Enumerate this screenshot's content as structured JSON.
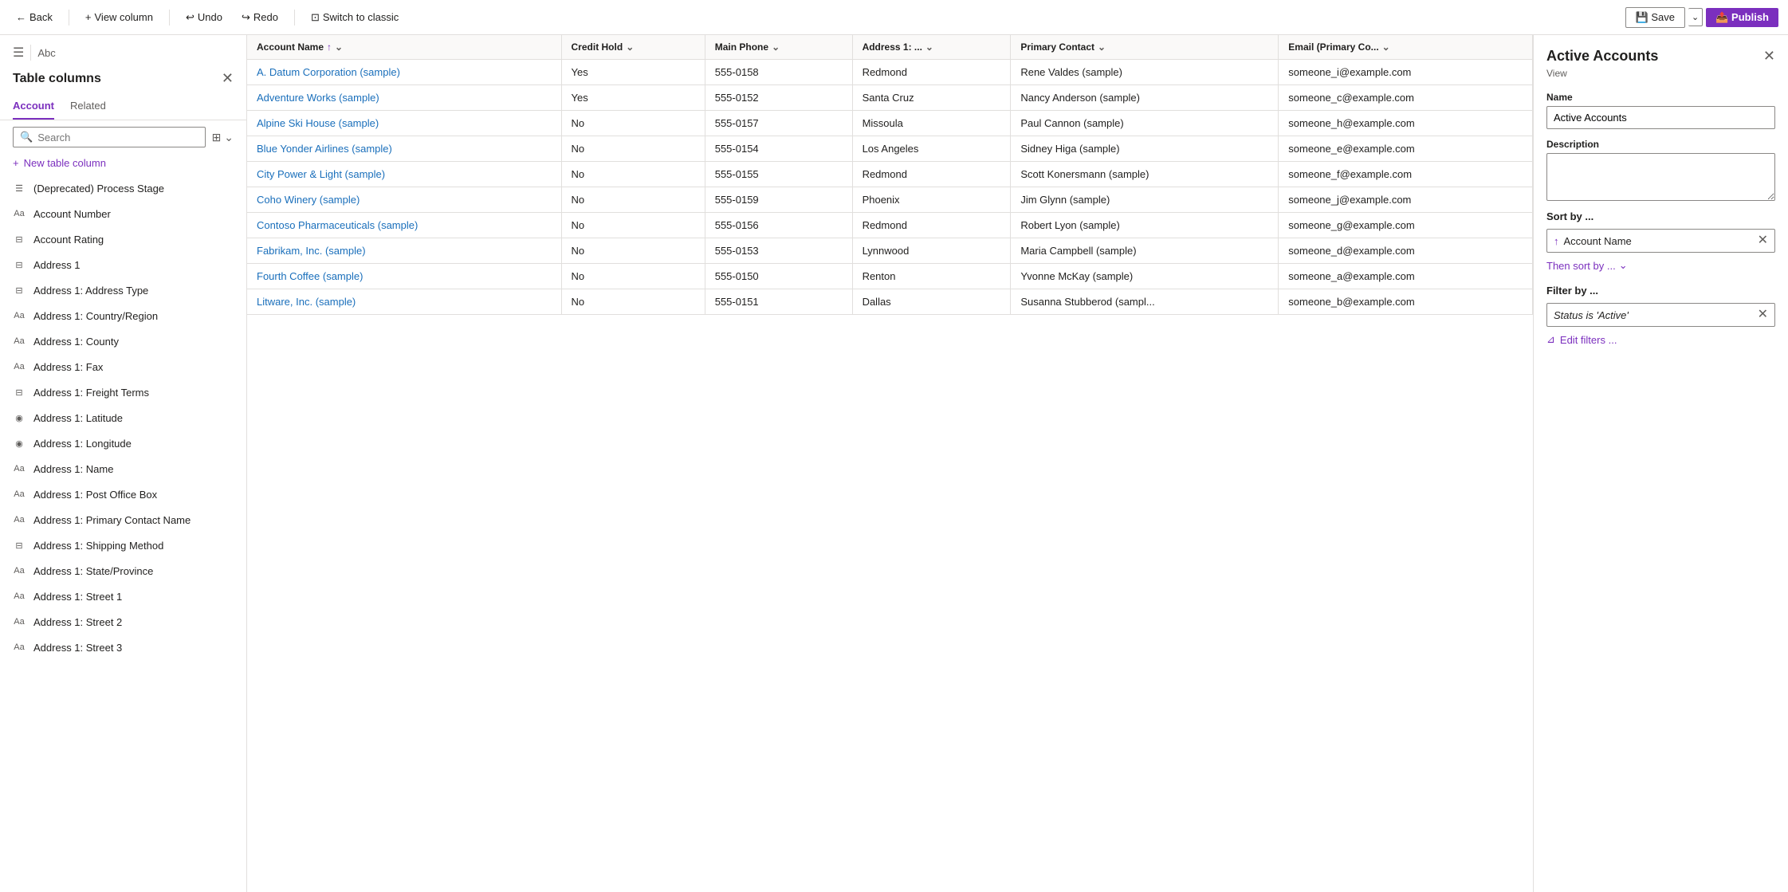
{
  "topbar": {
    "back_label": "Back",
    "view_column_label": "View column",
    "undo_label": "Undo",
    "redo_label": "Redo",
    "switch_label": "Switch to classic",
    "save_label": "Save",
    "publish_label": "Publish"
  },
  "sidebar": {
    "title": "Table columns",
    "close_icon": "✕",
    "tabs": [
      {
        "label": "Account",
        "active": true
      },
      {
        "label": "Related",
        "active": false
      }
    ],
    "search_placeholder": "Search",
    "new_column_label": "New table column",
    "columns": [
      {
        "label": "(Deprecated) Process Stage",
        "icon_type": "list"
      },
      {
        "label": "Account Number",
        "icon_type": "text"
      },
      {
        "label": "Account Rating",
        "icon_type": "select"
      },
      {
        "label": "Address 1",
        "icon_type": "select"
      },
      {
        "label": "Address 1: Address Type",
        "icon_type": "select"
      },
      {
        "label": "Address 1: Country/Region",
        "icon_type": "text"
      },
      {
        "label": "Address 1: County",
        "icon_type": "text"
      },
      {
        "label": "Address 1: Fax",
        "icon_type": "text"
      },
      {
        "label": "Address 1: Freight Terms",
        "icon_type": "select"
      },
      {
        "label": "Address 1: Latitude",
        "icon_type": "globe"
      },
      {
        "label": "Address 1: Longitude",
        "icon_type": "globe"
      },
      {
        "label": "Address 1: Name",
        "icon_type": "text"
      },
      {
        "label": "Address 1: Post Office Box",
        "icon_type": "text"
      },
      {
        "label": "Address 1: Primary Contact Name",
        "icon_type": "text"
      },
      {
        "label": "Address 1: Shipping Method",
        "icon_type": "select"
      },
      {
        "label": "Address 1: State/Province",
        "icon_type": "text"
      },
      {
        "label": "Address 1: Street 1",
        "icon_type": "text"
      },
      {
        "label": "Address 1: Street 2",
        "icon_type": "text"
      },
      {
        "label": "Address 1: Street 3",
        "icon_type": "text"
      }
    ]
  },
  "table": {
    "columns": [
      {
        "label": "Account Name",
        "sort": "asc",
        "has_filter": true
      },
      {
        "label": "Credit Hold",
        "has_filter": true
      },
      {
        "label": "Main Phone",
        "has_filter": true
      },
      {
        "label": "Address 1: ...",
        "has_filter": true
      },
      {
        "label": "Primary Contact",
        "has_filter": true
      },
      {
        "label": "Email (Primary Co...",
        "has_filter": true
      }
    ],
    "rows": [
      {
        "name": "A. Datum Corporation (sample)",
        "credit_hold": "Yes",
        "phone": "555-0158",
        "address": "Redmond",
        "contact": "Rene Valdes (sample)",
        "email": "someone_i@example.com"
      },
      {
        "name": "Adventure Works (sample)",
        "credit_hold": "Yes",
        "phone": "555-0152",
        "address": "Santa Cruz",
        "contact": "Nancy Anderson (sample)",
        "email": "someone_c@example.com"
      },
      {
        "name": "Alpine Ski House (sample)",
        "credit_hold": "No",
        "phone": "555-0157",
        "address": "Missoula",
        "contact": "Paul Cannon (sample)",
        "email": "someone_h@example.com"
      },
      {
        "name": "Blue Yonder Airlines (sample)",
        "credit_hold": "No",
        "phone": "555-0154",
        "address": "Los Angeles",
        "contact": "Sidney Higa (sample)",
        "email": "someone_e@example.com"
      },
      {
        "name": "City Power & Light (sample)",
        "credit_hold": "No",
        "phone": "555-0155",
        "address": "Redmond",
        "contact": "Scott Konersmann (sample)",
        "email": "someone_f@example.com"
      },
      {
        "name": "Coho Winery (sample)",
        "credit_hold": "No",
        "phone": "555-0159",
        "address": "Phoenix",
        "contact": "Jim Glynn (sample)",
        "email": "someone_j@example.com"
      },
      {
        "name": "Contoso Pharmaceuticals (sample)",
        "credit_hold": "No",
        "phone": "555-0156",
        "address": "Redmond",
        "contact": "Robert Lyon (sample)",
        "email": "someone_g@example.com"
      },
      {
        "name": "Fabrikam, Inc. (sample)",
        "credit_hold": "No",
        "phone": "555-0153",
        "address": "Lynnwood",
        "contact": "Maria Campbell (sample)",
        "email": "someone_d@example.com"
      },
      {
        "name": "Fourth Coffee (sample)",
        "credit_hold": "No",
        "phone": "555-0150",
        "address": "Renton",
        "contact": "Yvonne McKay (sample)",
        "email": "someone_a@example.com"
      },
      {
        "name": "Litware, Inc. (sample)",
        "credit_hold": "No",
        "phone": "555-0151",
        "address": "Dallas",
        "contact": "Susanna Stubberod (sampl...",
        "email": "someone_b@example.com"
      }
    ]
  },
  "right_panel": {
    "title": "Active Accounts",
    "subtitle": "View",
    "close_icon": "✕",
    "name_label": "Name",
    "name_value": "Active Accounts",
    "description_label": "Description",
    "description_value": "",
    "sort_label": "Sort by ...",
    "sort_field": "Account Name",
    "sort_direction_icon": "↑",
    "then_sort_label": "Then sort by ...",
    "filter_label": "Filter by ...",
    "filter_value": "Status is 'Active'",
    "edit_filters_label": "Edit filters ..."
  },
  "icons": {
    "back": "←",
    "add": "+",
    "undo": "↩",
    "redo": "↪",
    "switch": "⊡",
    "save": "💾",
    "publish": "📤",
    "search": "🔍",
    "filter": "⊞",
    "chevron_down": "⌄",
    "sort_asc": "↑",
    "close": "✕",
    "list_icon": "☰",
    "text_icon": "Aa",
    "select_icon": "⊟",
    "globe_icon": "◉",
    "edit_filters": "⊿"
  }
}
